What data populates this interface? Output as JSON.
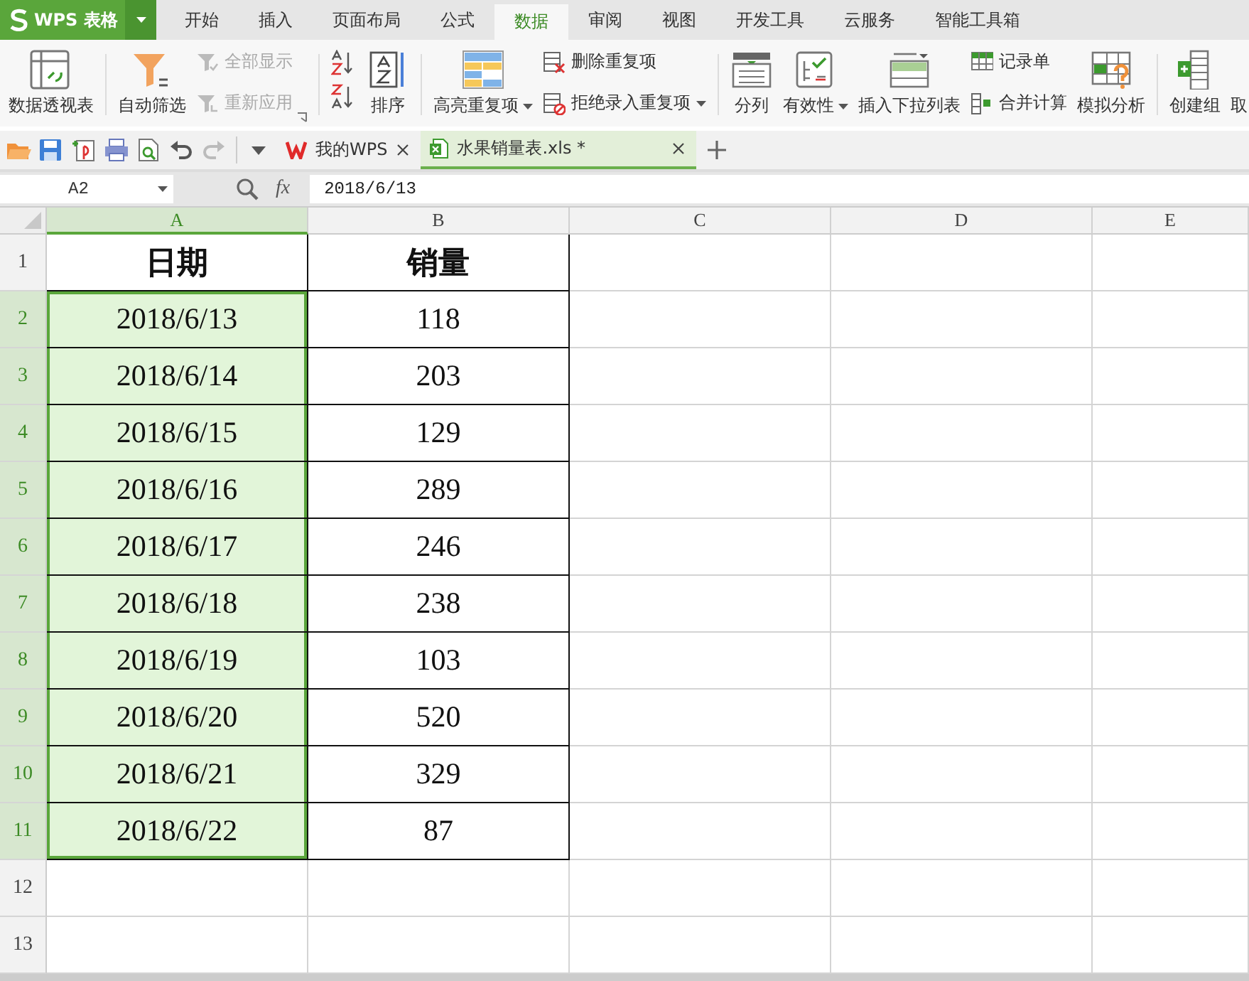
{
  "app": {
    "logo": "WPS 表格"
  },
  "menu_tabs": [
    {
      "label": "开始",
      "selected": false
    },
    {
      "label": "插入",
      "selected": false
    },
    {
      "label": "页面布局",
      "selected": false
    },
    {
      "label": "公式",
      "selected": false
    },
    {
      "label": "数据",
      "selected": true
    },
    {
      "label": "审阅",
      "selected": false
    },
    {
      "label": "视图",
      "selected": false
    },
    {
      "label": "开发工具",
      "selected": false
    },
    {
      "label": "云服务",
      "selected": false
    },
    {
      "label": "智能工具箱",
      "selected": false
    }
  ],
  "ribbon_groups": [
    [
      {
        "kind": "large",
        "label": "数据透视表",
        "dropdown": false
      }
    ],
    [
      {
        "kind": "large",
        "label": "自动筛选",
        "dropdown": false
      },
      {
        "kind": "stack",
        "items": [
          {
            "label": "全部显示",
            "disabled": true,
            "dropdown": false
          },
          {
            "label": "重新应用",
            "disabled": true,
            "dropdown": false
          }
        ]
      },
      {
        "kind": "launcher"
      }
    ],
    [
      {
        "kind": "sort-icons"
      },
      {
        "kind": "large",
        "label": "排序",
        "dropdown": false
      }
    ],
    [
      {
        "kind": "large",
        "label": "高亮重复项",
        "dropdown": true
      },
      {
        "kind": "stack",
        "items": [
          {
            "label": "删除重复项",
            "disabled": false,
            "dropdown": false
          },
          {
            "label": "拒绝录入重复项",
            "disabled": false,
            "dropdown": true
          }
        ]
      }
    ],
    [
      {
        "kind": "large",
        "label": "分列",
        "dropdown": false
      },
      {
        "kind": "large",
        "label": "有效性",
        "dropdown": true
      },
      {
        "kind": "large",
        "label": "插入下拉列表",
        "dropdown": false
      },
      {
        "kind": "stack",
        "items": [
          {
            "label": "记录单",
            "disabled": false,
            "dropdown": false
          },
          {
            "label": "合并计算",
            "disabled": false,
            "dropdown": false
          }
        ]
      },
      {
        "kind": "large",
        "label": "模拟分析",
        "dropdown": false
      }
    ],
    [
      {
        "kind": "large",
        "label": "创建组",
        "dropdown": false
      },
      {
        "kind": "cut",
        "label": "取"
      }
    ]
  ],
  "doc_tabs": [
    {
      "label": "我的WPS",
      "kind": "home",
      "selected": false
    },
    {
      "label": "水果销量表.xls *",
      "kind": "sheet",
      "selected": true
    }
  ],
  "formula_bar": {
    "name_box": "A2",
    "fx_label": "fx",
    "value": "2018/6/13"
  },
  "sheet": {
    "columns": [
      {
        "label": "A",
        "selected": true
      },
      {
        "label": "B",
        "selected": false
      },
      {
        "label": "C",
        "selected": false
      },
      {
        "label": "D",
        "selected": false
      },
      {
        "label": "E",
        "selected": false
      }
    ],
    "rows": [
      {
        "number": "1",
        "selected": false,
        "cells": [
          {
            "text": "日期",
            "selected": false,
            "bold": true
          },
          {
            "text": "销量",
            "selected": false,
            "bold": true
          }
        ]
      },
      {
        "number": "2",
        "selected": true,
        "cells": [
          {
            "text": "2018/6/13",
            "selected": true,
            "bold": false
          },
          {
            "text": "118",
            "selected": false,
            "bold": false
          }
        ]
      },
      {
        "number": "3",
        "selected": true,
        "cells": [
          {
            "text": "2018/6/14",
            "selected": true,
            "bold": false
          },
          {
            "text": "203",
            "selected": false,
            "bold": false
          }
        ]
      },
      {
        "number": "4",
        "selected": true,
        "cells": [
          {
            "text": "2018/6/15",
            "selected": true,
            "bold": false
          },
          {
            "text": "129",
            "selected": false,
            "bold": false
          }
        ]
      },
      {
        "number": "5",
        "selected": true,
        "cells": [
          {
            "text": "2018/6/16",
            "selected": true,
            "bold": false
          },
          {
            "text": "289",
            "selected": false,
            "bold": false
          }
        ]
      },
      {
        "number": "6",
        "selected": true,
        "cells": [
          {
            "text": "2018/6/17",
            "selected": true,
            "bold": false
          },
          {
            "text": "246",
            "selected": false,
            "bold": false
          }
        ]
      },
      {
        "number": "7",
        "selected": true,
        "cells": [
          {
            "text": "2018/6/18",
            "selected": true,
            "bold": false
          },
          {
            "text": "238",
            "selected": false,
            "bold": false
          }
        ]
      },
      {
        "number": "8",
        "selected": true,
        "cells": [
          {
            "text": "2018/6/19",
            "selected": true,
            "bold": false
          },
          {
            "text": "103",
            "selected": false,
            "bold": false
          }
        ]
      },
      {
        "number": "9",
        "selected": true,
        "cells": [
          {
            "text": "2018/6/20",
            "selected": true,
            "bold": false
          },
          {
            "text": "520",
            "selected": false,
            "bold": false
          }
        ]
      },
      {
        "number": "10",
        "selected": true,
        "cells": [
          {
            "text": "2018/6/21",
            "selected": true,
            "bold": false
          },
          {
            "text": "329",
            "selected": false,
            "bold": false
          }
        ]
      },
      {
        "number": "11",
        "selected": true,
        "cells": [
          {
            "text": "2018/6/22",
            "selected": true,
            "bold": false
          },
          {
            "text": "87",
            "selected": false,
            "bold": false
          }
        ]
      },
      {
        "number": "12",
        "selected": false
      },
      {
        "number": "13",
        "selected": false
      }
    ]
  }
}
